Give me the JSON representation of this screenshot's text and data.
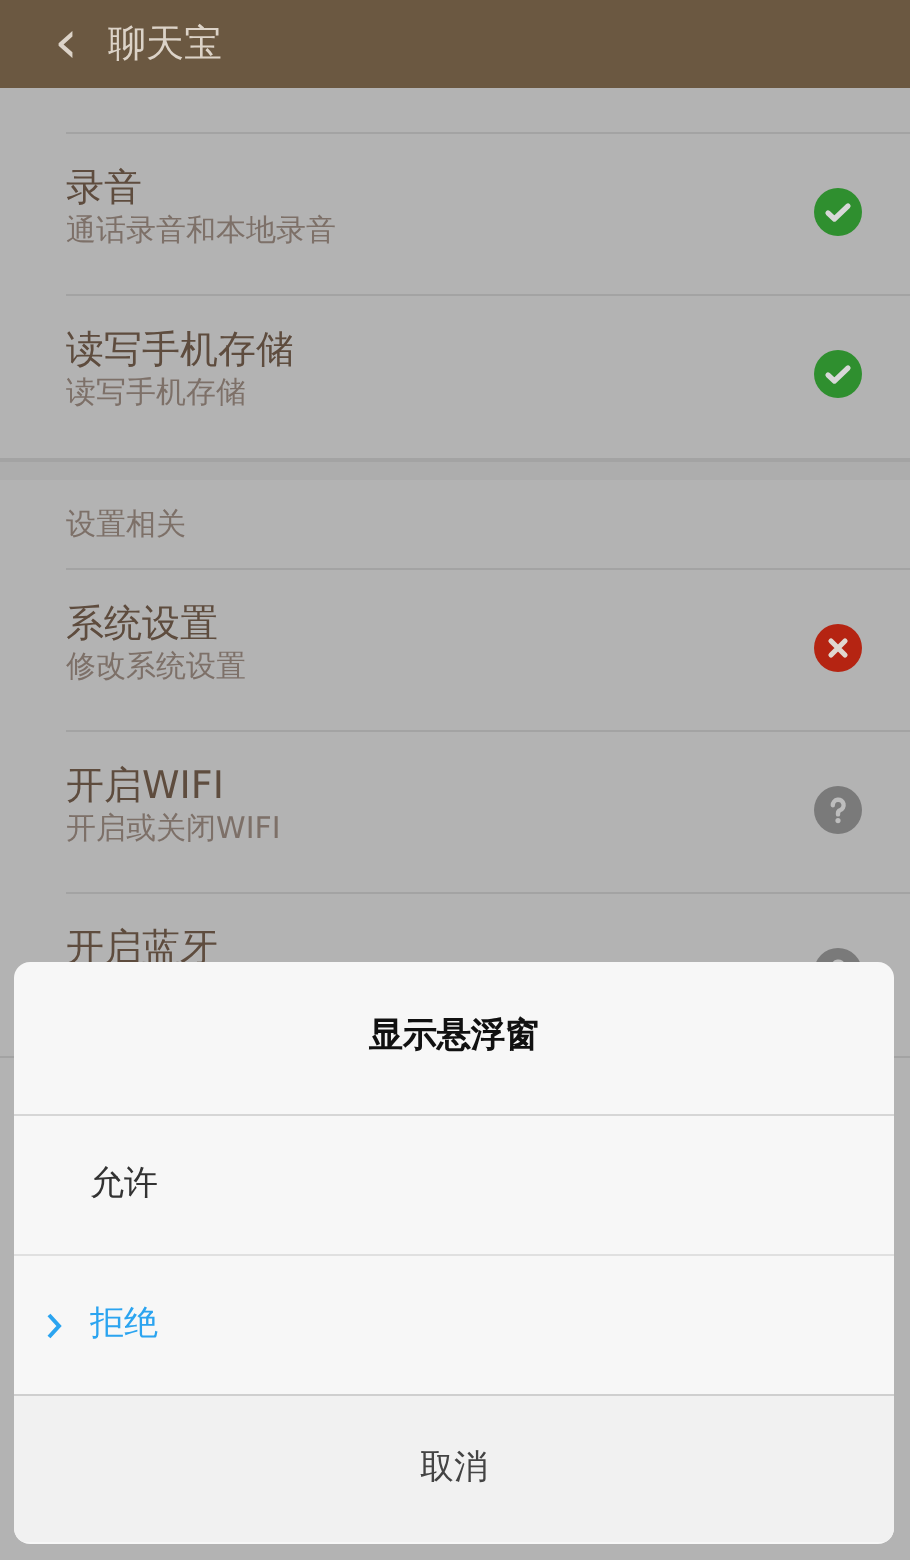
{
  "header": {
    "back_icon": "‹",
    "title": "聊天宝"
  },
  "sections": [
    {
      "items": [
        {
          "title": "录音",
          "subtitle": "通话录音和本地录音",
          "kind": "allowed"
        },
        {
          "title": "读写手机存储",
          "subtitle": "读写手机存储",
          "kind": "allowed"
        }
      ]
    },
    {
      "heading": "设置相关",
      "items": [
        {
          "title": "系统设置",
          "subtitle": "修改系统设置",
          "kind": "denied"
        },
        {
          "title": "开启WIFI",
          "subtitle": "开启或关闭WIFI",
          "kind": "ask"
        },
        {
          "title": "开启蓝牙",
          "kind": "ask"
        }
      ]
    }
  ],
  "dialog": {
    "title": "显示悬浮窗",
    "options": [
      {
        "label": "允许",
        "selected": false
      },
      {
        "label": "拒绝",
        "selected": true
      }
    ],
    "cancel": "取消"
  }
}
